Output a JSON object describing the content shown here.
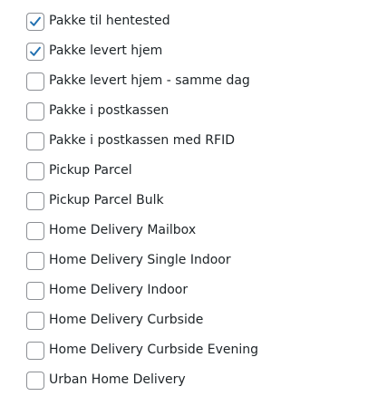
{
  "colors": {
    "checkmark": "#2271b1",
    "checkbox_border": "#8c8f94",
    "label_text": "#1d2327"
  },
  "options": [
    {
      "label": "Pakke til hentested",
      "checked": true
    },
    {
      "label": "Pakke levert hjem",
      "checked": true
    },
    {
      "label": "Pakke levert hjem - samme dag",
      "checked": false
    },
    {
      "label": "Pakke i postkassen",
      "checked": false
    },
    {
      "label": "Pakke i postkassen med RFID",
      "checked": false
    },
    {
      "label": "Pickup Parcel",
      "checked": false
    },
    {
      "label": "Pickup Parcel Bulk",
      "checked": false
    },
    {
      "label": "Home Delivery Mailbox",
      "checked": false
    },
    {
      "label": "Home Delivery Single Indoor",
      "checked": false
    },
    {
      "label": "Home Delivery Indoor",
      "checked": false
    },
    {
      "label": "Home Delivery Curbside",
      "checked": false
    },
    {
      "label": "Home Delivery Curbside Evening",
      "checked": false
    },
    {
      "label": "Urban Home Delivery",
      "checked": false
    }
  ]
}
